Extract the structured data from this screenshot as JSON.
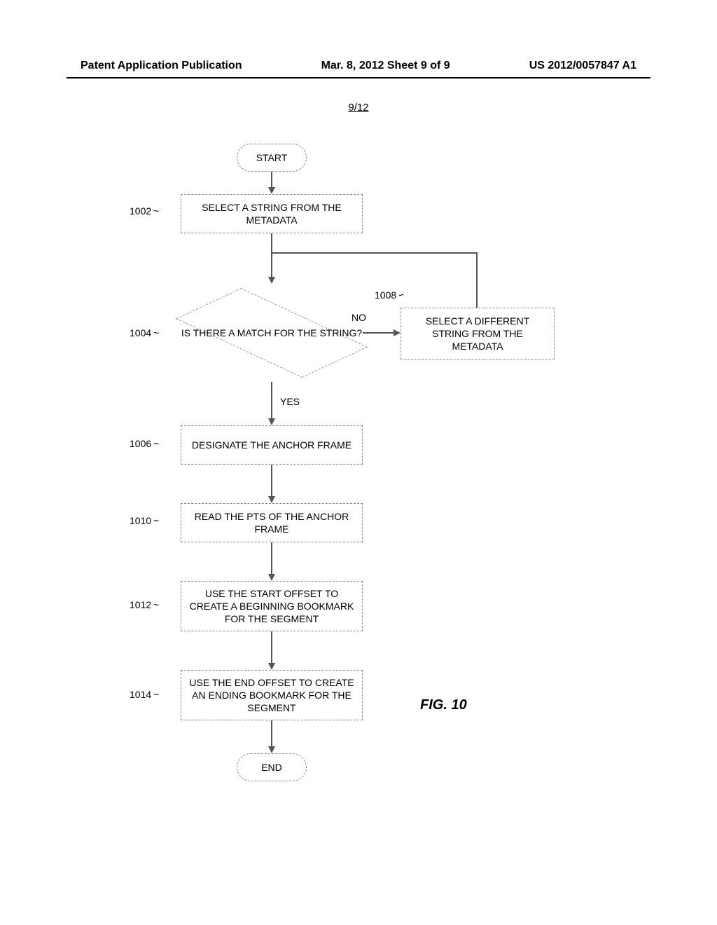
{
  "header": {
    "left": "Patent Application Publication",
    "center": "Mar. 8, 2012  Sheet 9 of 9",
    "right": "US 2012/0057847 A1"
  },
  "page_fraction": "9/12",
  "flowchart": {
    "start": "START",
    "end": "END",
    "steps": {
      "s1002": {
        "ref": "1002",
        "text": "SELECT A STRING FROM THE METADATA"
      },
      "s1004": {
        "ref": "1004",
        "text": "IS THERE A MATCH FOR THE STRING?"
      },
      "s1006": {
        "ref": "1006",
        "text": "DESIGNATE THE ANCHOR FRAME"
      },
      "s1008": {
        "ref": "1008",
        "text": "SELECT A DIFFERENT STRING FROM THE METADATA"
      },
      "s1010": {
        "ref": "1010",
        "text": "READ THE PTS OF THE ANCHOR FRAME"
      },
      "s1012": {
        "ref": "1012",
        "text": "USE THE START OFFSET TO CREATE A BEGINNING BOOKMARK FOR THE SEGMENT"
      },
      "s1014": {
        "ref": "1014",
        "text": "USE THE END OFFSET TO CREATE AN ENDING BOOKMARK FOR THE SEGMENT"
      }
    },
    "edges": {
      "no": "NO",
      "yes": "YES"
    }
  },
  "figure_label": "FIG. 10",
  "chart_data": {
    "type": "flowchart",
    "title": "FIG. 10",
    "nodes": [
      {
        "id": "start",
        "type": "terminator",
        "label": "START"
      },
      {
        "id": "1002",
        "type": "process",
        "label": "SELECT A STRING FROM THE METADATA"
      },
      {
        "id": "1004",
        "type": "decision",
        "label": "IS THERE A MATCH FOR THE STRING?"
      },
      {
        "id": "1006",
        "type": "process",
        "label": "DESIGNATE THE ANCHOR FRAME"
      },
      {
        "id": "1008",
        "type": "process",
        "label": "SELECT A DIFFERENT STRING FROM THE METADATA"
      },
      {
        "id": "1010",
        "type": "process",
        "label": "READ THE PTS OF THE ANCHOR FRAME"
      },
      {
        "id": "1012",
        "type": "process",
        "label": "USE THE START OFFSET TO CREATE A BEGINNING BOOKMARK FOR THE SEGMENT"
      },
      {
        "id": "1014",
        "type": "process",
        "label": "USE THE END OFFSET TO CREATE AN ENDING BOOKMARK FOR THE SEGMENT"
      },
      {
        "id": "end",
        "type": "terminator",
        "label": "END"
      }
    ],
    "edges": [
      {
        "from": "start",
        "to": "1002"
      },
      {
        "from": "1002",
        "to": "1004"
      },
      {
        "from": "1004",
        "to": "1006",
        "label": "YES"
      },
      {
        "from": "1004",
        "to": "1008",
        "label": "NO"
      },
      {
        "from": "1008",
        "to": "1004"
      },
      {
        "from": "1006",
        "to": "1010"
      },
      {
        "from": "1010",
        "to": "1012"
      },
      {
        "from": "1012",
        "to": "1014"
      },
      {
        "from": "1014",
        "to": "end"
      }
    ]
  }
}
